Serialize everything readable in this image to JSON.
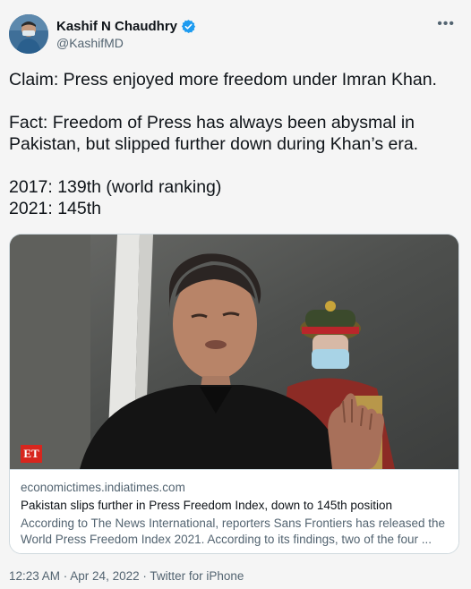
{
  "author": {
    "display_name": "Kashif N Chaudhry",
    "handle": "@KashifMD",
    "verified": true
  },
  "icons": {
    "verified": "verified-badge-icon",
    "more": "more-options-icon"
  },
  "tweet": {
    "lines": [
      "Claim: Press enjoyed more freedom under Imran Khan.",
      "",
      "Fact: Freedom of Press has always been abysmal in",
      "Pakistan, but slipped further down during Khan’s era.",
      "",
      "2017: 139th (world ranking)",
      "2021: 145th"
    ]
  },
  "card": {
    "logo_text": "ET",
    "domain": "economictimes.indiatimes.com",
    "title": "Pakistan slips further in Press Freedom Index, down to 145th position",
    "description": "According to The News International, reporters Sans Frontiers has released the World Press Freedom Index 2021. According to its findings, two of the four ..."
  },
  "footer": {
    "timestamp": "12:23 AM · Apr 24, 2022 · Twitter for iPhone"
  },
  "colors": {
    "verified_blue": "#1d9bf0",
    "text_primary": "#0f1419",
    "text_secondary": "#536471",
    "et_red": "#d7261e"
  }
}
